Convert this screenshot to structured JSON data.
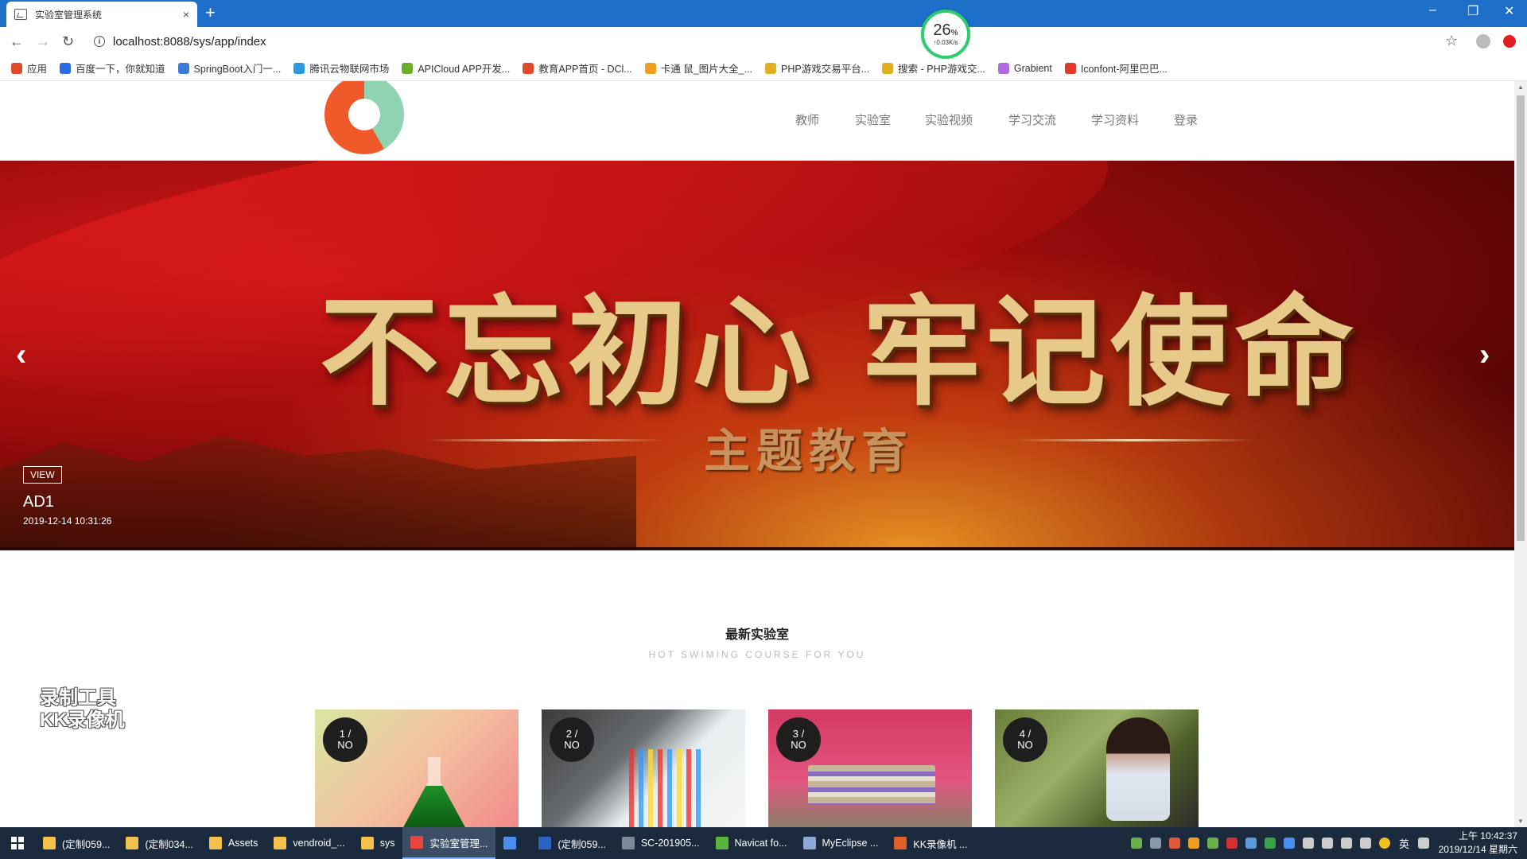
{
  "browser": {
    "tab_title": "实验室管理系统",
    "tab_close": "×",
    "new_tab": "+",
    "url": "localhost:8088/sys/app/index",
    "window_controls": [
      "–",
      "❐",
      "✕"
    ],
    "speed_widget": {
      "percent": "26",
      "percent_sign": "%",
      "rate": "↑0.03K/s"
    },
    "bookmarks": [
      {
        "label": "应用",
        "color": "#e04a2a"
      },
      {
        "label": "百度一下，你就知道",
        "color": "#2a6be0"
      },
      {
        "label": "SpringBoot入门一...",
        "color": "#3a7bd5"
      },
      {
        "label": "腾讯云物联网市场",
        "color": "#2a9ae0"
      },
      {
        "label": "APICloud APP开发...",
        "color": "#6aae2a"
      },
      {
        "label": "教育APP首页 - DCl...",
        "color": "#e04a2a"
      },
      {
        "label": "卡通 鼠_图片大全_...",
        "color": "#f0a020"
      },
      {
        "label": "PHP游戏交易平台...",
        "color": "#e0b020"
      },
      {
        "label": "搜索 - PHP游戏交...",
        "color": "#e0b020"
      },
      {
        "label": "Grabient",
        "color": "#b06ae0"
      },
      {
        "label": "Iconfont-阿里巴巴...",
        "color": "#e03a2a"
      }
    ]
  },
  "site": {
    "nav": [
      "教师",
      "实验室",
      "实验视频",
      "学习交流",
      "学习资料",
      "登录"
    ],
    "hero": {
      "slogan": "不忘初心 牢记使命",
      "subtitle": "主题教育",
      "view_label": "VIEW",
      "title": "AD1",
      "date": "2019-12-14 10:31:26",
      "prev": "‹",
      "next": "›"
    },
    "section": {
      "title": "最新实验室",
      "subtitle": "HOT SWIMING COURSE FOR YOU"
    },
    "cards": [
      {
        "num": "1 /",
        "label": "NO"
      },
      {
        "num": "2 /",
        "label": "NO"
      },
      {
        "num": "3 /",
        "label": "NO"
      },
      {
        "num": "4 /",
        "label": "NO"
      }
    ],
    "watermark": [
      "录制工具",
      "KK录像机"
    ]
  },
  "taskbar": {
    "items": [
      {
        "label": "(定制059...",
        "color": "#f2c14e"
      },
      {
        "label": "(定制034...",
        "color": "#f2c14e"
      },
      {
        "label": "Assets",
        "color": "#f2c14e"
      },
      {
        "label": "vendroid_...",
        "color": "#f2c14e"
      },
      {
        "label": "sys",
        "color": "#f2c14e"
      },
      {
        "label": "实验室管理...",
        "color": "#e8453c",
        "active": true
      },
      {
        "label": "",
        "color": "#4a8ff0"
      },
      {
        "label": "(定制059...",
        "color": "#2b63c4"
      },
      {
        "label": "SC-201905...",
        "color": "#7a8a99"
      },
      {
        "label": "Navicat fo...",
        "color": "#5ab43a"
      },
      {
        "label": "MyEclipse ...",
        "color": "#8fa8d8"
      },
      {
        "label": "KK录像机 ...",
        "color": "#e0602a"
      }
    ],
    "input_lang": "英",
    "time": "上午 10:42:37",
    "date": "2019/12/14 星期六"
  }
}
